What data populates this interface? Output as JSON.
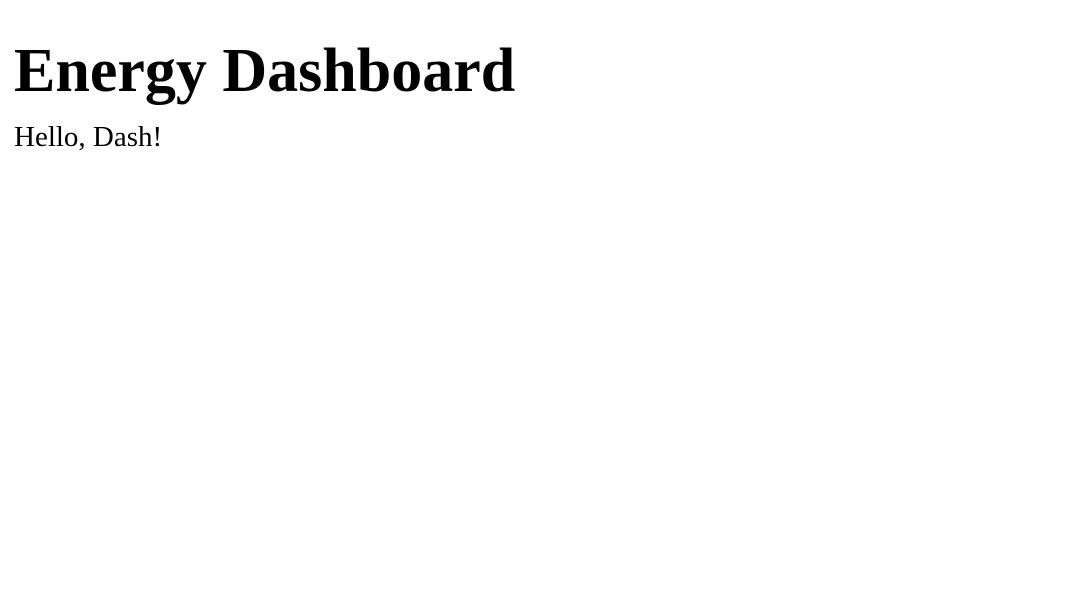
{
  "header": {
    "title": "Energy Dashboard"
  },
  "main": {
    "greeting": "Hello, Dash!"
  },
  "colors": {
    "background": "#ffffff",
    "text": "#000000"
  }
}
